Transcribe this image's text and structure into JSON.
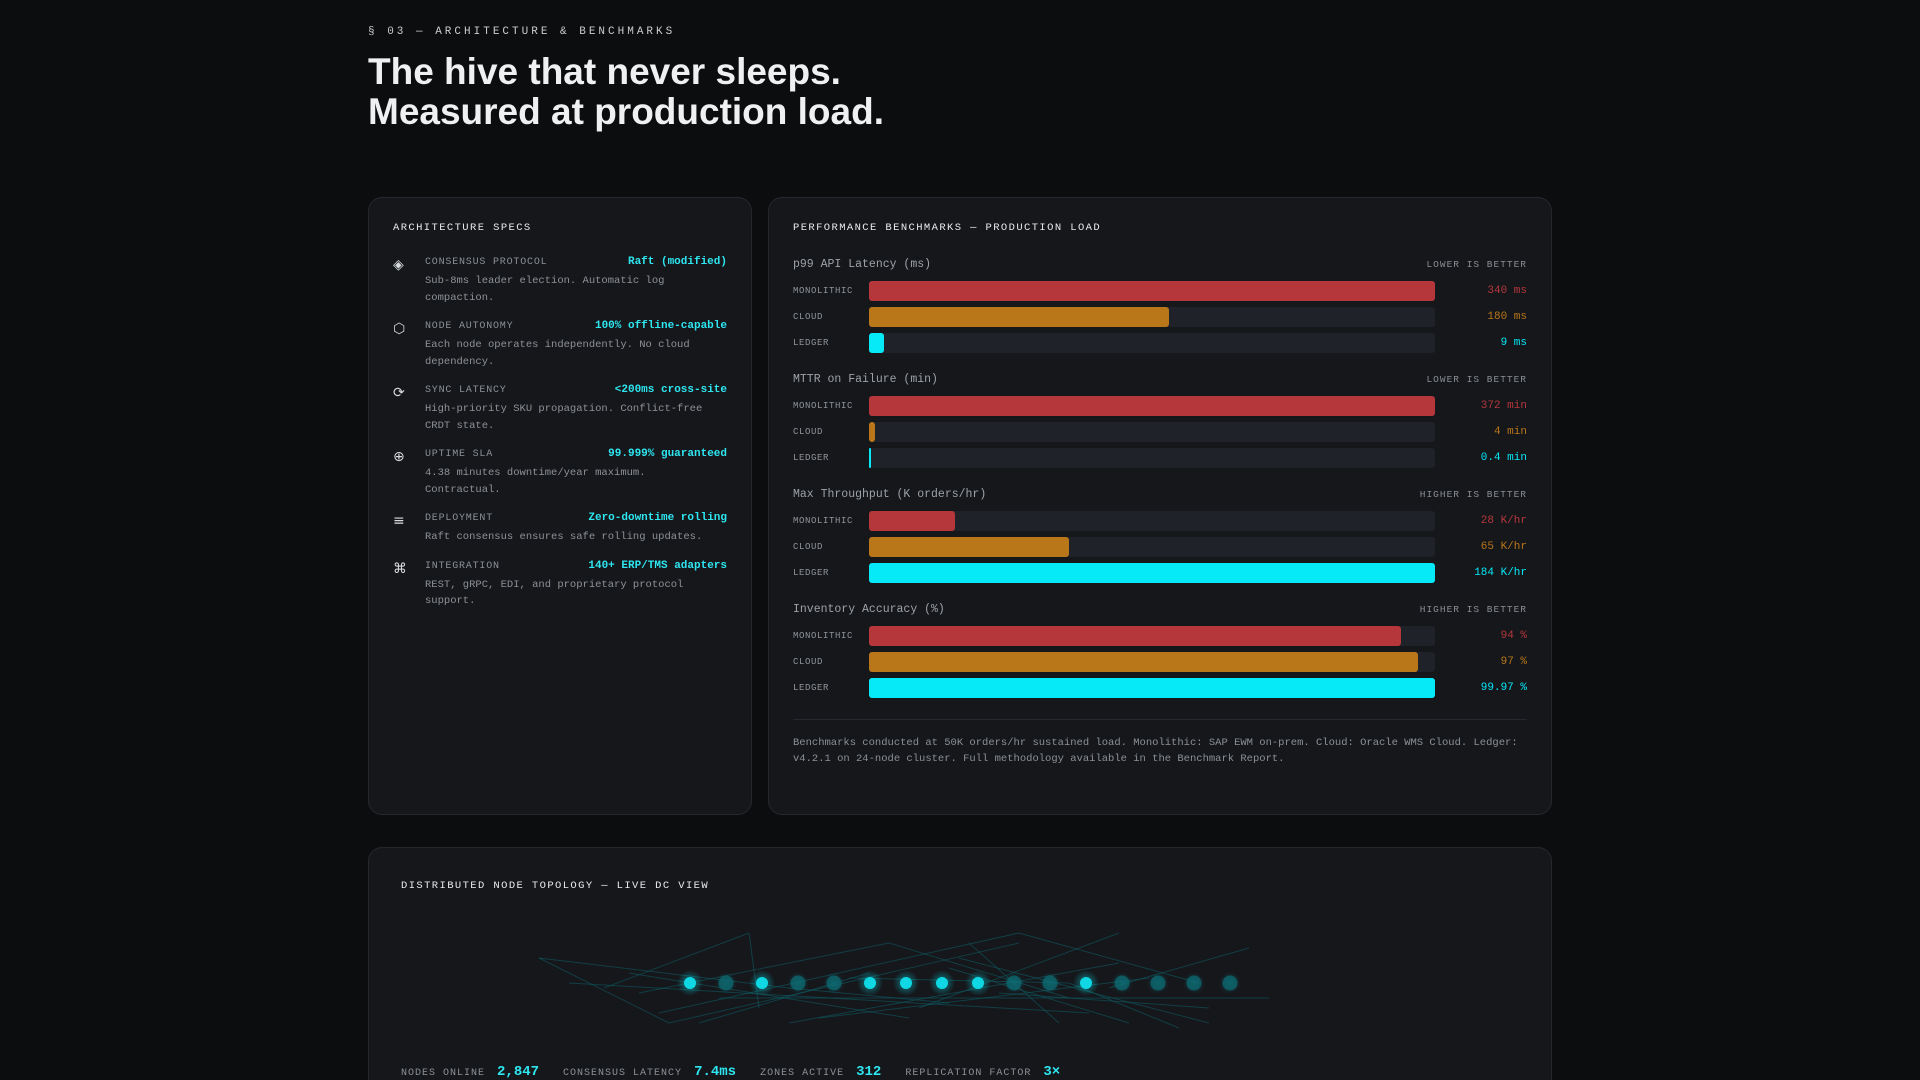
{
  "header": {
    "eyebrow": "§ 03 — ARCHITECTURE & BENCHMARKS",
    "headline_line1": "The hive that never sleeps.",
    "headline_line2": "Measured at production load."
  },
  "colors": {
    "monolithic": "#b5373c",
    "cloud": "#b9771a",
    "ledger": "#06eaf8",
    "accent": "#2ee6f0"
  },
  "architecture": {
    "title": "ARCHITECTURE SPECS",
    "specs": [
      {
        "icon": "diamond-icon",
        "glyph": "◈",
        "label": "CONSENSUS PROTOCOL",
        "value": "Raft (modified)",
        "desc": "Sub-8ms leader election. Automatic log compaction."
      },
      {
        "icon": "hexagon-icon",
        "glyph": "⬡",
        "label": "NODE AUTONOMY",
        "value": "100% offline-capable",
        "desc": "Each node operates independently. No cloud dependency."
      },
      {
        "icon": "sync-icon",
        "glyph": "⟳",
        "label": "SYNC LATENCY",
        "value": "<200ms cross-site",
        "desc": "High-priority SKU propagation. Conflict-free CRDT state."
      },
      {
        "icon": "circle-plus-icon",
        "glyph": "⊕",
        "label": "UPTIME SLA",
        "value": "99.999% guaranteed",
        "desc": "4.38 minutes downtime/year maximum. Contractual."
      },
      {
        "icon": "menu-lines-icon",
        "glyph": "≡",
        "label": "DEPLOYMENT",
        "value": "Zero-downtime rolling",
        "desc": "Raft consensus ensures safe rolling updates."
      },
      {
        "icon": "command-icon",
        "glyph": "⌘",
        "label": "INTEGRATION",
        "value": "140+ ERP/TMS adapters",
        "desc": "REST, gRPC, EDI, and proprietary protocol support."
      }
    ]
  },
  "benchmarks": {
    "title": "PERFORMANCE BENCHMARKS — PRODUCTION LOAD",
    "groups": [
      {
        "name": "p99 API Latency (ms)",
        "hint": "LOWER IS BETTER",
        "rows": [
          {
            "system": "MONOLITHIC",
            "key": "monolithic",
            "value": 340,
            "display": "340 ms",
            "fraction": 1.0
          },
          {
            "system": "CLOUD",
            "key": "cloud",
            "value": 180,
            "display": "180 ms",
            "fraction": 0.53
          },
          {
            "system": "LEDGER",
            "key": "ledger",
            "value": 9,
            "display": "9 ms",
            "fraction": 0.026
          }
        ]
      },
      {
        "name": "MTTR on Failure (min)",
        "hint": "LOWER IS BETTER",
        "rows": [
          {
            "system": "MONOLITHIC",
            "key": "monolithic",
            "value": 372,
            "display": "372 min",
            "fraction": 1.0
          },
          {
            "system": "CLOUD",
            "key": "cloud",
            "value": 4,
            "display": "4 min",
            "fraction": 0.011
          },
          {
            "system": "LEDGER",
            "key": "ledger",
            "value": 0.4,
            "display": "0.4 min",
            "fraction": 0.0011
          }
        ]
      },
      {
        "name": "Max Throughput (K orders/hr)",
        "hint": "HIGHER IS BETTER",
        "rows": [
          {
            "system": "MONOLITHIC",
            "key": "monolithic",
            "value": 28,
            "display": "28 K/hr",
            "fraction": 0.152
          },
          {
            "system": "CLOUD",
            "key": "cloud",
            "value": 65,
            "display": "65 K/hr",
            "fraction": 0.353
          },
          {
            "system": "LEDGER",
            "key": "ledger",
            "value": 184,
            "display": "184 K/hr",
            "fraction": 1.0
          }
        ]
      },
      {
        "name": "Inventory Accuracy (%)",
        "hint": "HIGHER IS BETTER",
        "rows": [
          {
            "system": "MONOLITHIC",
            "key": "monolithic",
            "value": 94,
            "display": "94 %",
            "fraction": 0.94
          },
          {
            "system": "CLOUD",
            "key": "cloud",
            "value": 97,
            "display": "97 %",
            "fraction": 0.97
          },
          {
            "system": "LEDGER",
            "key": "ledger",
            "value": 99.97,
            "display": "99.97 %",
            "fraction": 1.0
          }
        ]
      }
    ],
    "note": "Benchmarks conducted at 50K orders/hr sustained load. Monolithic: SAP EWM on-prem. Cloud: Oracle WMS Cloud. Ledger: v4.2.1 on 24-node cluster. Full methodology available in the Benchmark Report."
  },
  "topology": {
    "title": "DISTRIBUTED NODE TOPOLOGY — LIVE DC VIEW",
    "nodes": [
      {
        "state": "active"
      },
      {
        "state": "idle"
      },
      {
        "state": "active"
      },
      {
        "state": "idle"
      },
      {
        "state": "idle"
      },
      {
        "state": "active"
      },
      {
        "state": "active"
      },
      {
        "state": "active"
      },
      {
        "state": "active"
      },
      {
        "state": "idle"
      },
      {
        "state": "idle"
      },
      {
        "state": "active"
      },
      {
        "state": "idle"
      },
      {
        "state": "idle"
      },
      {
        "state": "idle"
      },
      {
        "state": "idle"
      }
    ],
    "stats": [
      {
        "label": "NODES ONLINE",
        "value": "2,847"
      },
      {
        "label": "CONSENSUS LATENCY",
        "value": "7.4ms"
      },
      {
        "label": "ZONES ACTIVE",
        "value": "312"
      },
      {
        "label": "REPLICATION FACTOR",
        "value": "3×"
      }
    ]
  }
}
